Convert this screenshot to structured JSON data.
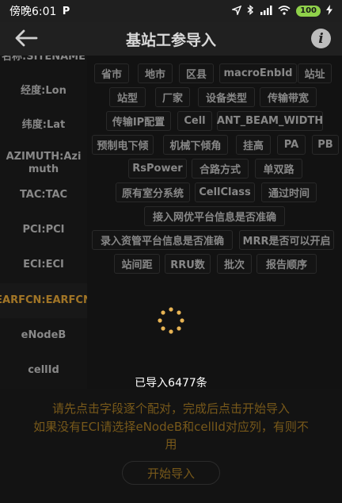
{
  "status_bar": {
    "time": "傍晚6:01",
    "app_icon": "P",
    "battery": "100",
    "signal": "HD"
  },
  "title_bar": {
    "title": "基站工参导入",
    "back_icon": "back-arrow-icon",
    "info_icon": "i"
  },
  "left_list": {
    "items": [
      {
        "label": "名称:SITENAME"
      },
      {
        "label": "经度:Lon"
      },
      {
        "label": "纬度:Lat"
      },
      {
        "label": "AZIMUTH:Azimuth"
      },
      {
        "label": "TAC:TAC"
      },
      {
        "label": "PCI:PCI"
      },
      {
        "label": "ECI:ECI"
      },
      {
        "label": "EARFCN:EARFCN",
        "active": true
      },
      {
        "label": "eNodeB"
      },
      {
        "label": "cellId"
      }
    ]
  },
  "chips": [
    "省市",
    "地市",
    "区县",
    "macroEnbId",
    "站址",
    "站型",
    "厂家",
    "设备类型",
    "传输带宽",
    "传输IP配置",
    "Cell",
    "ANT_BEAM_WIDTH",
    "预制电下倾",
    "机械下倾角",
    "挂高",
    "PA",
    "PB",
    "RsPower",
    "合路方式",
    "单双路",
    "原有室分系统",
    "CellClass",
    "通过时间",
    "接入网优平台信息是否准确",
    "录入资管平台信息是否准确",
    "MRR是否可以开启",
    "站间距",
    "RRU数",
    "批次",
    "报告顺序"
  ],
  "loading": {
    "count_text": "已导入6477条"
  },
  "bottom": {
    "instruction_line1": "请先点击字段逐个配对，完成后点击开始导入",
    "instruction_line2": "如果没有ECI请选择eNodeB和cellId对应列，有则不",
    "instruction_line3": "用",
    "start_button": "开始导入"
  },
  "colors": {
    "accent": "#e0a235",
    "background": "#1a1a1a",
    "chip_border": "#3a3a3a",
    "spinner": "#e8b454"
  }
}
